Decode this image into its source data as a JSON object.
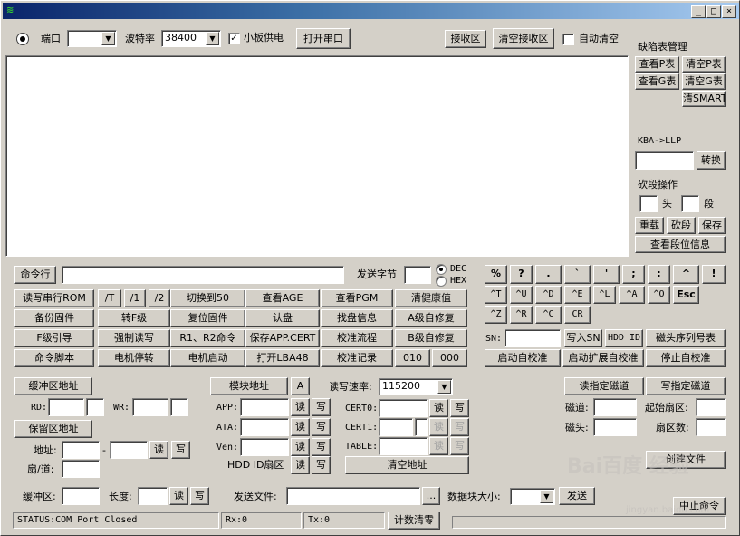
{
  "window": {
    "controls": {
      "minimize": "_",
      "maximize": "□",
      "close": "×"
    }
  },
  "top": {
    "port_label": "端口",
    "baud_label": "波特率",
    "baud_value": "38400",
    "board_power_label": "小板供电",
    "board_power_checked": "✓",
    "open_port": "打开串口",
    "recv_area": "接收区",
    "clear_recv": "清空接收区",
    "auto_clear_label": "自动清空"
  },
  "right_panel": {
    "defect_title": "缺陷表管理",
    "view_p": "查看P表",
    "clear_p": "清空P表",
    "view_g": "查看G表",
    "clear_g": "清空G表",
    "clear_smart": "清SMART",
    "kba_title": "KBA->LLP",
    "convert": "转换",
    "cut_title": "砍段操作",
    "head_label": "头",
    "seg_label": "段",
    "reload": "重载",
    "cut": "砍段",
    "save": "保存",
    "view_seg": "查看段位信息"
  },
  "cmd": {
    "cmd_line_btn": "命令行",
    "send_bytes_label": "发送字节",
    "dec": "DEC",
    "hex": "HEX"
  },
  "func_grid": {
    "row1": [
      "读写串行ROM",
      "/T",
      "/1",
      "/2",
      "切换到50",
      "查看AGE",
      "查看PGM",
      "清健康值"
    ],
    "row2": [
      "备份固件",
      "转F级",
      "复位固件",
      "认盘",
      "找盘信息",
      "A级自修复"
    ],
    "row3": [
      "F级引导",
      "强制读写",
      "R1、R2命令",
      "保存APP.CERT",
      "校准流程",
      "B级自修复"
    ],
    "row4": [
      "命令脚本",
      "电机停转",
      "电机启动",
      "打开LBA48",
      "校准记录",
      "010",
      "000"
    ]
  },
  "keys": {
    "row1": [
      "%",
      "?",
      ".",
      "`",
      "'",
      ";",
      ":",
      "^",
      "!"
    ],
    "row2": [
      "^T",
      "^U",
      "^D",
      "^E",
      "^L",
      "^A",
      "^O",
      "Esc"
    ],
    "row3": [
      "^Z",
      "^R",
      "^C",
      "CR"
    ]
  },
  "sn": {
    "label": "SN:",
    "write_sn": "写入SN",
    "hdd_id": "HDD ID",
    "head_serial": "磁头序列号表",
    "start_calib": "启动自校准",
    "start_ext_calib": "启动扩展自校准",
    "stop_calib": "停止自校准"
  },
  "buffer": {
    "buf_addr": "缓冲区地址",
    "rd": "RD:",
    "wr": "WR:",
    "reserved_addr": "保留区地址",
    "addr": "地址:",
    "dash": "-",
    "read": "读",
    "write": "写",
    "sector_track": "扇/道:"
  },
  "module": {
    "module_addr": "模块地址",
    "a": "A",
    "app": "APP:",
    "ata": "ATA:",
    "ven": "Ven:",
    "hdd_id_sector": "HDD ID扇区",
    "read": "读",
    "write": "写"
  },
  "rw_rate": {
    "label": "读写速率:",
    "value": "115200",
    "cert0": "CERT0:",
    "cert1": "CERT1:",
    "table": "TABLE:",
    "read": "读",
    "write": "写",
    "clear_addr": "清空地址"
  },
  "track": {
    "read_track": "读指定磁道",
    "write_track": "写指定磁道",
    "track": "磁道:",
    "start_sector": "起始扇区:",
    "head": "磁头:",
    "sector_count": "扇区数:",
    "create_file": "创建文件"
  },
  "bottom": {
    "buffer_label": "缓冲区:",
    "length_label": "长度:",
    "read": "读",
    "write": "写",
    "send_file": "发送文件:",
    "browse": "...",
    "block_size": "数据块大小:",
    "send": "发送",
    "abort": "中止命令"
  },
  "statusbar": {
    "status": "STATUS:COM Port Closed",
    "rx": "Rx:0",
    "tx": "Tx:0",
    "reset_count": "计数清零"
  },
  "watermark": {
    "brand": "Bai百度 经验",
    "url": "jingyan.baidu.com"
  }
}
